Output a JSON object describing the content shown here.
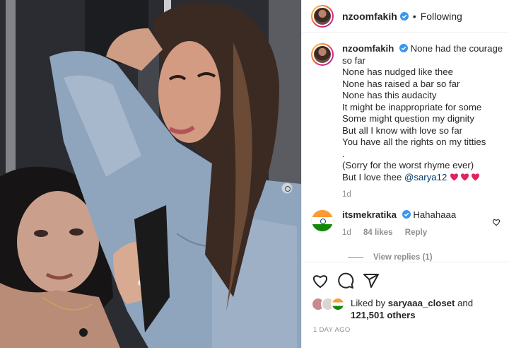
{
  "post": {
    "username": "nzoomfakih",
    "follow_state": "Following",
    "separator": "•"
  },
  "caption": {
    "username": "nzoomfakih",
    "lines": [
      "None had the courage",
      "so far",
      "None has nudged like thee",
      "None has raised a bar so far",
      "None has this audacity",
      "It might be inappropriate for some",
      "Some might question my dignity",
      "But all I know with love so far",
      "You have all the rights on my titties",
      ".",
      "(Sorry for the worst rhyme ever)",
      "But I love thee"
    ],
    "mention": "@sarya12",
    "age": "1d"
  },
  "comment": {
    "username": "itsmekratika",
    "text": "Hahahaaa",
    "age": "1d",
    "likes": "84 likes",
    "reply": "Reply",
    "view_replies": "View replies (1)"
  },
  "likes": {
    "prefix": "Liked by",
    "user": "saryaaa_closet",
    "and": "and",
    "others": "121,501 others"
  },
  "timestamp": "1 DAY AGO",
  "icons": {
    "like": "heart-icon",
    "comment": "comment-icon",
    "share": "share-icon",
    "verified": "verified-badge-icon"
  },
  "colors": {
    "verified": "#3897f0",
    "heart": "#ed4956",
    "mention": "#00376b",
    "muted": "#8e8e8e"
  }
}
